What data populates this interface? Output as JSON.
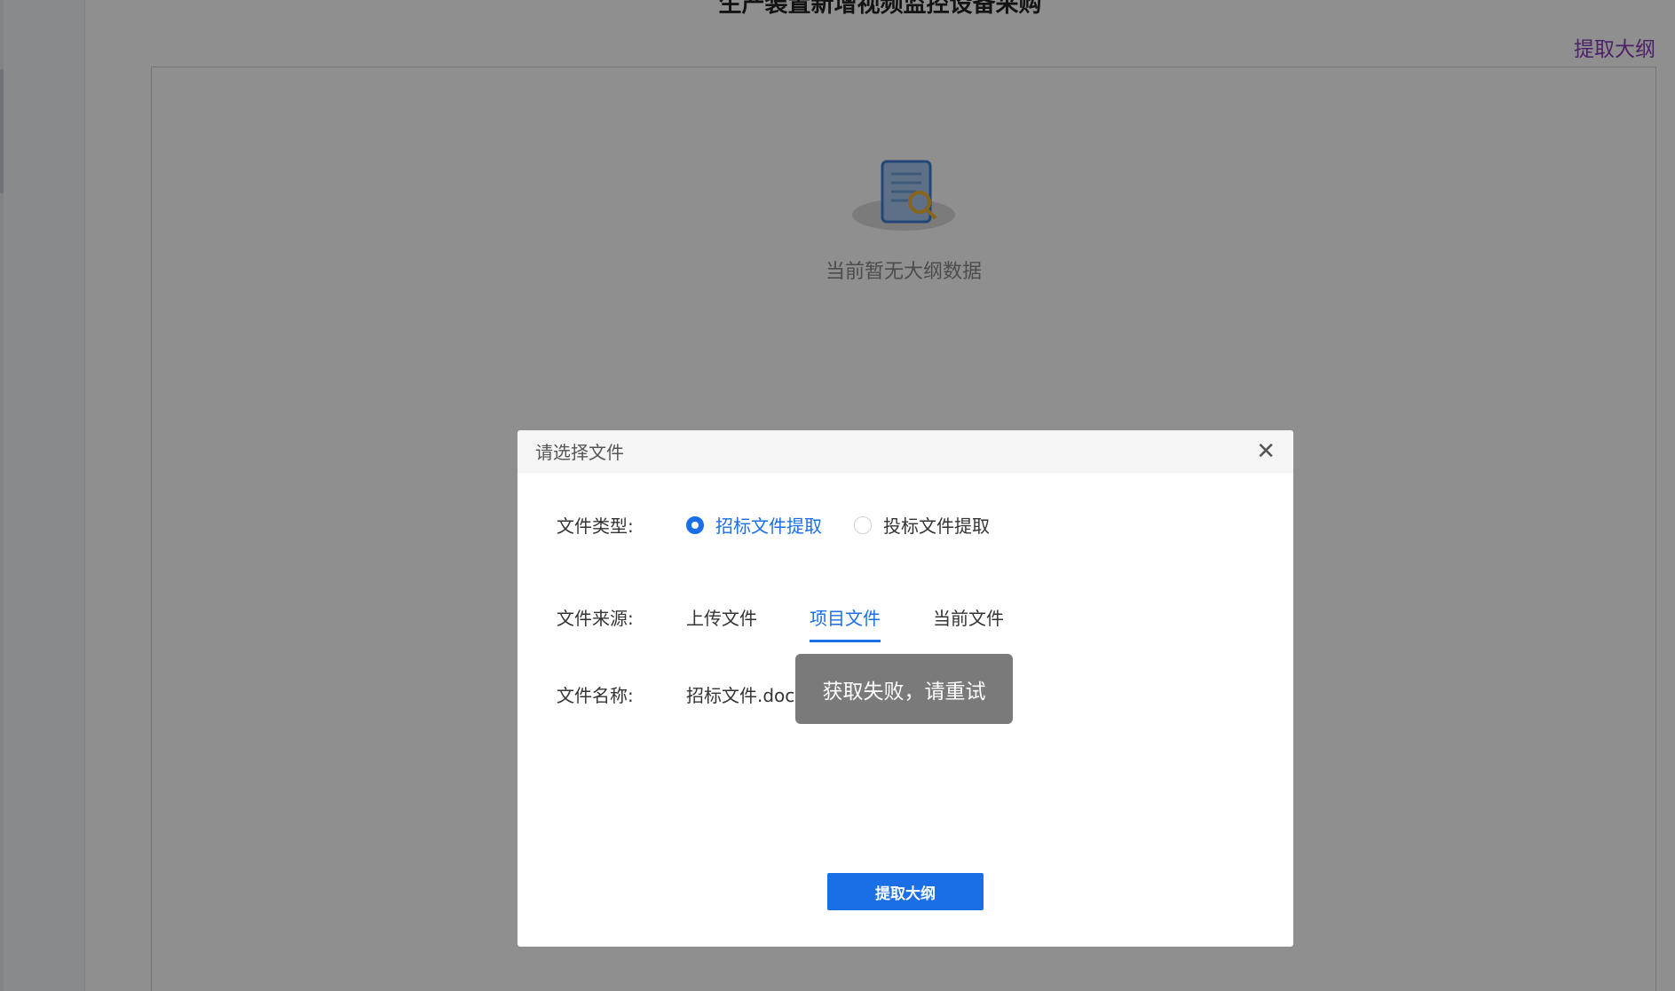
{
  "page": {
    "title": "生产装置新增视频监控设备采购",
    "extract_outline_link": "提取大纲",
    "empty_state_text": "当前暂无大纲数据"
  },
  "modal": {
    "title": "请选择文件",
    "close_icon": "close-icon",
    "file_type": {
      "label": "文件类型:",
      "options": [
        {
          "label": "招标文件提取",
          "selected": true
        },
        {
          "label": "投标文件提取",
          "selected": false
        }
      ]
    },
    "file_source": {
      "label": "文件来源:",
      "tabs": [
        {
          "label": "上传文件",
          "active": false
        },
        {
          "label": "项目文件",
          "active": true
        },
        {
          "label": "当前文件",
          "active": false
        }
      ]
    },
    "file_name": {
      "label": "文件名称:",
      "value": "招标文件.docx"
    },
    "toast": "获取失败，请重试",
    "submit_label": "提取大纲"
  },
  "colors": {
    "accent": "#1a6fe6",
    "link": "#8a3ab9",
    "overlay": "rgba(0,0,0,0.44)"
  }
}
